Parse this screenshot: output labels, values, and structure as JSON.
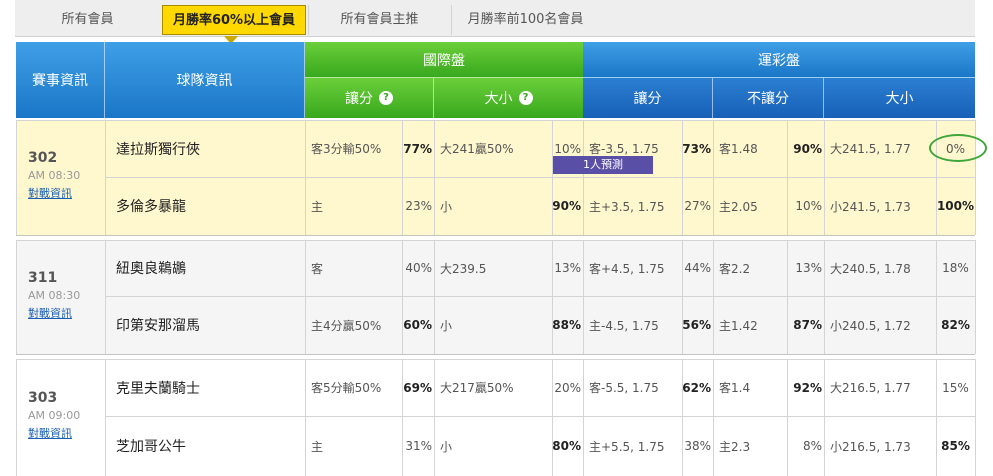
{
  "tabs": [
    {
      "label": "所有會員"
    },
    {
      "label": "月勝率60%以上會員"
    },
    {
      "label": "所有會員主推"
    },
    {
      "label": "月勝率前100名會員"
    }
  ],
  "header": {
    "game_info": "賽事資訊",
    "team_info": "球隊資訊",
    "intl": "國際盤",
    "sports_lottery": "運彩盤",
    "handicap": "讓分",
    "over_under": "大小",
    "no_handicap": "不讓分",
    "help_icon": "?"
  },
  "predict_label": "1人預測",
  "games": [
    {
      "id": "302",
      "time": "AM 08:30",
      "link": "對戰資訊",
      "rows": [
        {
          "team": "達拉斯獨行俠",
          "intl_spread": "客3分輸50%",
          "intl_spread_pct": "77%",
          "intl_ou": "大241贏50%",
          "intl_ou_pct": "10%",
          "lot_spread": "客-3.5, 1.75",
          "lot_spread_pct": "73%",
          "lot_ml": "客1.48",
          "lot_ml_pct": "90%",
          "lot_ou": "大241.5, 1.77",
          "lot_ou_pct": "0%"
        },
        {
          "team": "多倫多暴龍",
          "intl_spread": "主",
          "intl_spread_pct": "23%",
          "intl_ou": "小",
          "intl_ou_pct": "90%",
          "lot_spread": "主+3.5, 1.75",
          "lot_spread_pct": "27%",
          "lot_ml": "主2.05",
          "lot_ml_pct": "10%",
          "lot_ou": "小241.5, 1.73",
          "lot_ou_pct": "100%"
        }
      ]
    },
    {
      "id": "311",
      "time": "AM 08:30",
      "link": "對戰資訊",
      "rows": [
        {
          "team": "紐奧良鵜鶘",
          "intl_spread": "客",
          "intl_spread_pct": "40%",
          "intl_ou": "大239.5",
          "intl_ou_pct": "13%",
          "lot_spread": "客+4.5, 1.75",
          "lot_spread_pct": "44%",
          "lot_ml": "客2.2",
          "lot_ml_pct": "13%",
          "lot_ou": "大240.5, 1.78",
          "lot_ou_pct": "18%"
        },
        {
          "team": "印第安那溜馬",
          "intl_spread": "主4分贏50%",
          "intl_spread_pct": "60%",
          "intl_ou": "小",
          "intl_ou_pct": "88%",
          "lot_spread": "主-4.5, 1.75",
          "lot_spread_pct": "56%",
          "lot_ml": "主1.42",
          "lot_ml_pct": "87%",
          "lot_ou": "小240.5, 1.72",
          "lot_ou_pct": "82%"
        }
      ]
    },
    {
      "id": "303",
      "time": "AM 09:00",
      "link": "對戰資訊",
      "rows": [
        {
          "team": "克里夫蘭騎士",
          "intl_spread": "客5分輸50%",
          "intl_spread_pct": "69%",
          "intl_ou": "大217贏50%",
          "intl_ou_pct": "20%",
          "lot_spread": "客-5.5, 1.75",
          "lot_spread_pct": "62%",
          "lot_ml": "客1.4",
          "lot_ml_pct": "92%",
          "lot_ou": "大216.5, 1.77",
          "lot_ou_pct": "15%"
        },
        {
          "team": "芝加哥公牛",
          "intl_spread": "主",
          "intl_spread_pct": "31%",
          "intl_ou": "小",
          "intl_ou_pct": "80%",
          "lot_spread": "主+5.5, 1.75",
          "lot_spread_pct": "38%",
          "lot_ml": "主2.3",
          "lot_ml_pct": "8%",
          "lot_ou": "小216.5, 1.73",
          "lot_ou_pct": "85%"
        }
      ]
    }
  ]
}
